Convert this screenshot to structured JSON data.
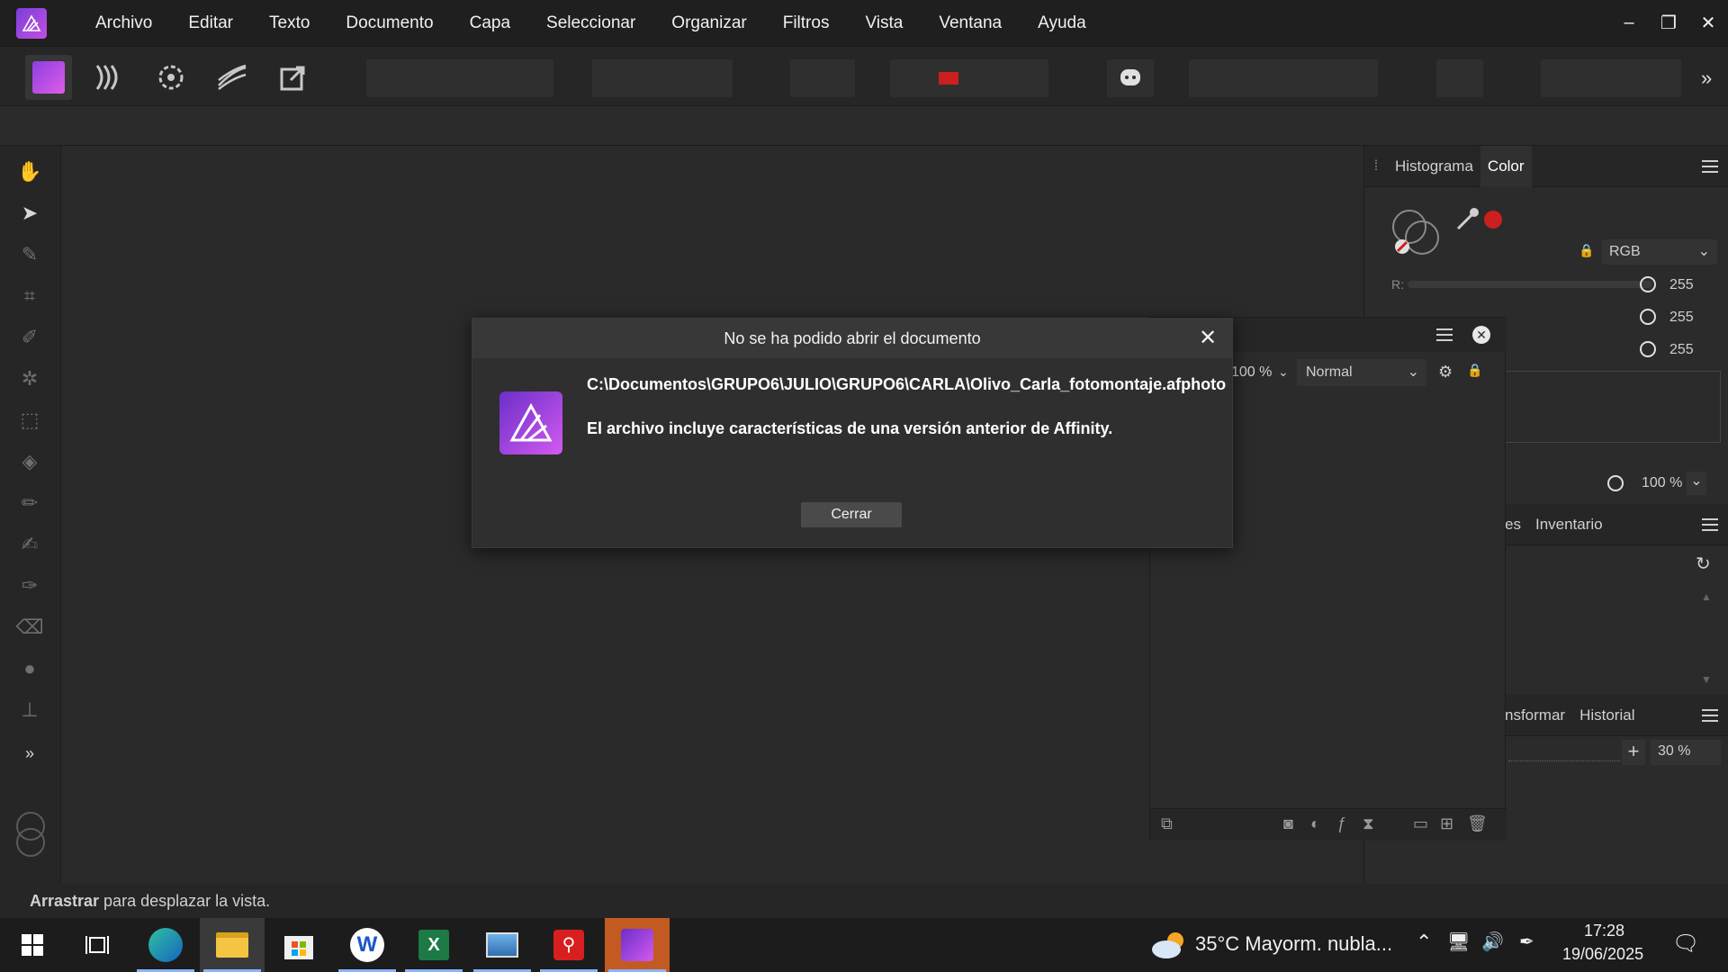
{
  "menu": {
    "items": [
      "Archivo",
      "Editar",
      "Texto",
      "Documento",
      "Capa",
      "Seleccionar",
      "Organizar",
      "Filtros",
      "Vista",
      "Ventana",
      "Ayuda"
    ]
  },
  "window_controls": {
    "minimize": "–",
    "restore": "❐",
    "close": "✕"
  },
  "toolbar": {
    "overflow": "»"
  },
  "right_panel": {
    "top_tabs": [
      "Histograma",
      "Color"
    ],
    "color_model": "RGB",
    "r_label": "R:",
    "r_value": "255",
    "g_value": "255",
    "b_value": "255",
    "opacity_value": "100 %",
    "mid_tabs": [
      "es",
      "Inventario"
    ],
    "bottom_tabs": [
      "nsformar",
      "Historial"
    ],
    "zoom_value": "30 %"
  },
  "layers_panel": {
    "opacity": "100 %",
    "blend_mode": "Normal"
  },
  "dialog": {
    "title": "No se ha podido abrir el documento",
    "path": "C:\\Documentos\\GRUPO6\\JULIO\\GRUPO6\\CARLA\\Olivo_Carla_fotomontaje.afphoto",
    "message": "El archivo incluye características de una versión anterior de Affinity.",
    "close_button": "Cerrar"
  },
  "status": {
    "bold": "Arrastrar",
    "rest": " para desplazar la vista."
  },
  "taskbar": {
    "weather": "35°C  Mayorm. nubla...",
    "time": "17:28",
    "date": "19/06/2025"
  },
  "colors": {
    "accent": "#c34fe0",
    "brand_purple": "#6a2fc8",
    "eyedropper_red": "#cc1f1f"
  }
}
